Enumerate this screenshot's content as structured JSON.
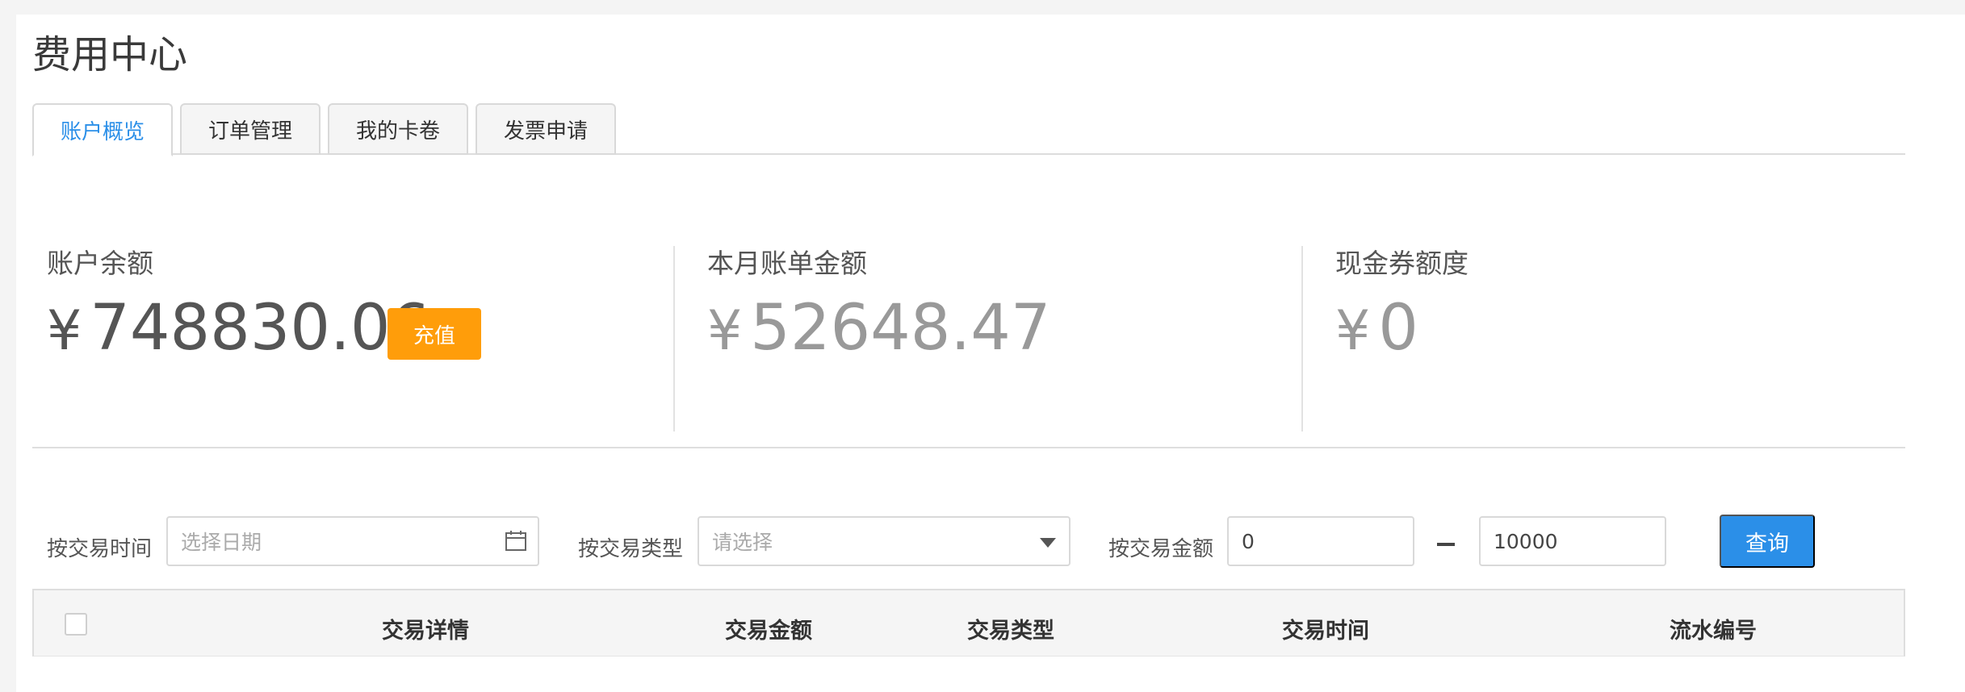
{
  "page": {
    "title": "费用中心"
  },
  "tabs": [
    {
      "label": "账户概览",
      "active": true
    },
    {
      "label": "订单管理",
      "active": false
    },
    {
      "label": "我的卡卷",
      "active": false
    },
    {
      "label": "发票申请",
      "active": false
    }
  ],
  "stats": {
    "currency": "¥",
    "balance": {
      "label": "账户余额",
      "value": "748830.06"
    },
    "monthly_bill": {
      "label": "本月账单金额",
      "value": "52648.47"
    },
    "coupon": {
      "label": "现金券额度",
      "value": "0"
    },
    "recharge_label": "充值"
  },
  "filters": {
    "time": {
      "label": "按交易时间",
      "placeholder": "选择日期",
      "icon": "calendar-icon"
    },
    "type": {
      "label": "按交易类型",
      "placeholder": "请选择",
      "icon": "caret-down-icon"
    },
    "amount": {
      "label": "按交易金额",
      "min": "0",
      "max": "10000",
      "separator": "–"
    },
    "query_label": "查询"
  },
  "table": {
    "columns": [
      "交易详情",
      "交易金额",
      "交易类型",
      "交易时间",
      "流水编号"
    ]
  },
  "colors": {
    "accent": "#2b8fe8",
    "recharge": "#ff9d0a",
    "background": "#f4f4f4"
  }
}
